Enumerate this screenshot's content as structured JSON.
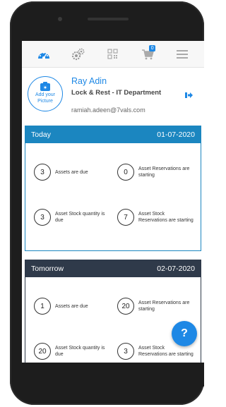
{
  "nav": {
    "items": [
      {
        "icon": "dashboard-gauge-icon"
      },
      {
        "icon": "settings-gears-icon"
      },
      {
        "icon": "qr-code-icon"
      },
      {
        "icon": "cart-icon",
        "badge": "0"
      },
      {
        "icon": "hamburger-menu-icon"
      }
    ]
  },
  "profile": {
    "add_picture_label": "Add your Picture",
    "name": "Ray Adin",
    "department": "Lock & Rest - IT Department",
    "email": "ramiah.adeen@7vals.com"
  },
  "today": {
    "title": "Today",
    "date": "01-07-2020",
    "stats": [
      {
        "count": "3",
        "label": "Assets are due"
      },
      {
        "count": "0",
        "label": "Asset Reservations are starting"
      },
      {
        "count": "3",
        "label": "Asset Stock quantity is due"
      },
      {
        "count": "7",
        "label": "Asset Stock Reservations are starting"
      }
    ]
  },
  "tomorrow": {
    "title": "Tomorrow",
    "date": "02-07-2020",
    "stats": [
      {
        "count": "1",
        "label": "Assets are due"
      },
      {
        "count": "20",
        "label": "Asset Reservations are starting"
      },
      {
        "count": "20",
        "label": "Asset Stock quantity is due"
      },
      {
        "count": "3",
        "label": "Asset Stock Reservations are starting"
      }
    ]
  },
  "help": {
    "label": "?"
  },
  "colors": {
    "accent": "#1e88e5",
    "today_header": "#1b86c0",
    "tomorrow_header": "#2f3a4a"
  }
}
